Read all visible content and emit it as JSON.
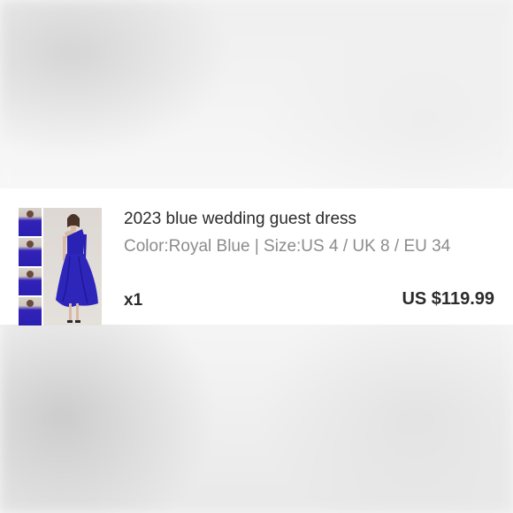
{
  "product": {
    "title": "2023 blue wedding guest dress",
    "attributes": "Color:Royal Blue | Size:US 4 / UK 8 / EU 34",
    "quantity": "x1",
    "price": "US $119.99",
    "color_hex": "#2a22b4"
  },
  "colors": {
    "background": "#f6f6f6",
    "card": "#ffffff",
    "text_primary": "#2b2b2b",
    "text_secondary": "#8c8c8c"
  }
}
